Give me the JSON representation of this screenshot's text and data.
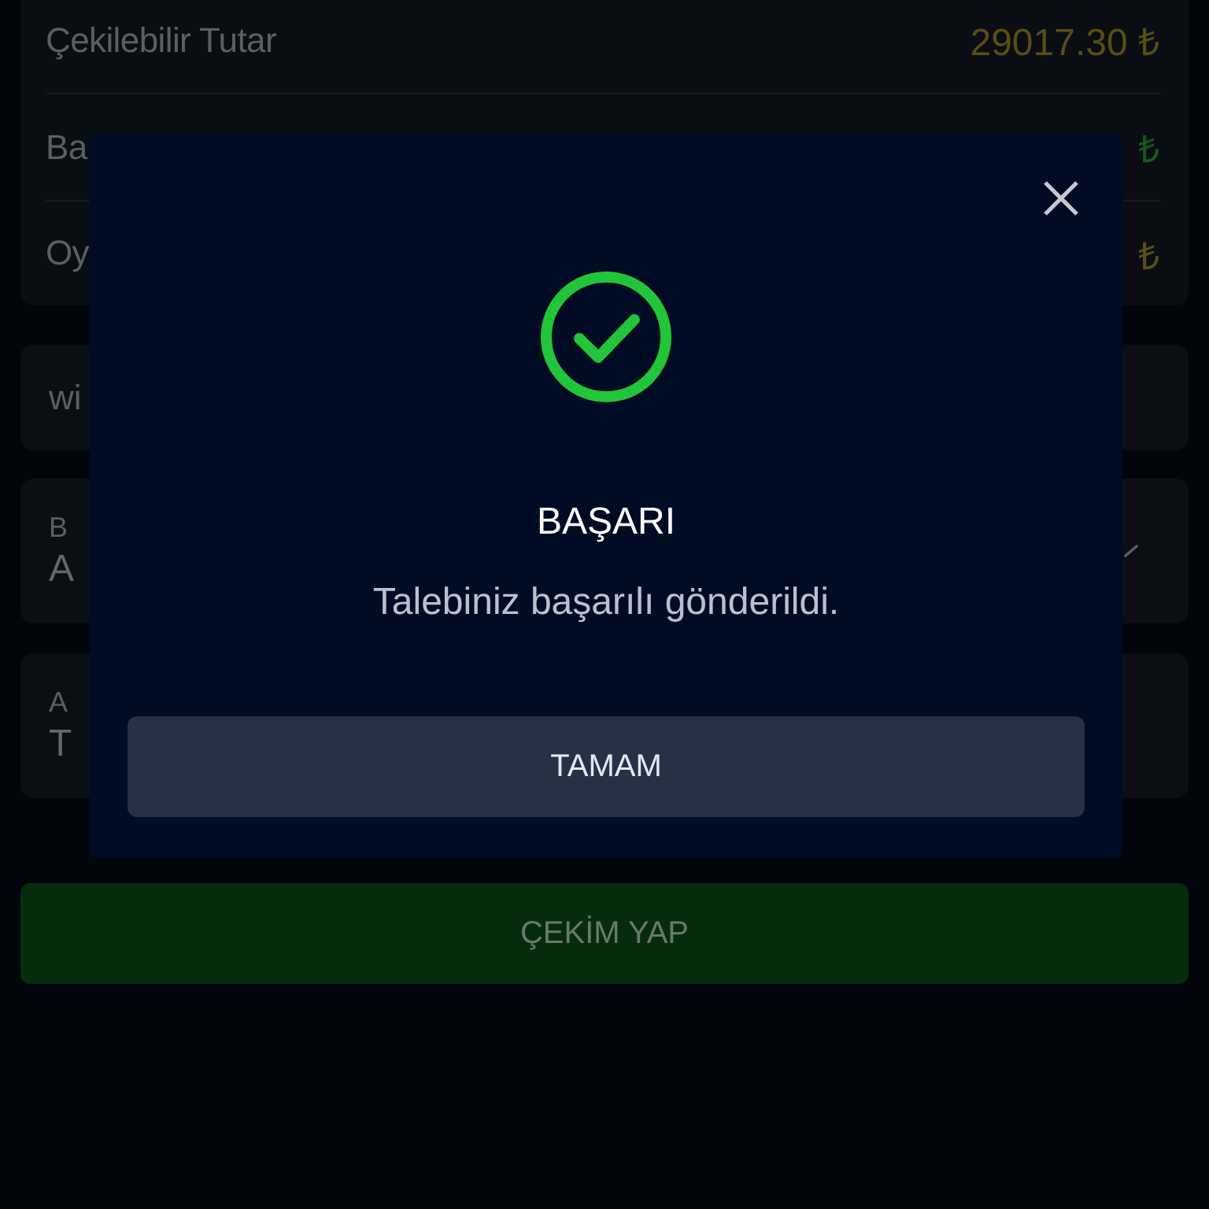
{
  "balance_rows": [
    {
      "label": "Çekilebilir Tutar",
      "value": "29017.30 ₺",
      "color": "#5a4d14"
    },
    {
      "label": "Ba",
      "value": "₺",
      "color": "#17581e"
    },
    {
      "label": "Oy",
      "value": "₺",
      "color": "#5a4d14"
    }
  ],
  "fields": [
    {
      "kind": "text",
      "value": "wi"
    },
    {
      "kind": "select",
      "label": "B",
      "value": "A"
    },
    {
      "kind": "text",
      "label": "A",
      "value": "T"
    }
  ],
  "submit_button": "ÇEKİM YAP",
  "dialog": {
    "title": "BAŞARI",
    "message": "Talebiniz başarılı gönderildi.",
    "button": "TAMAM"
  }
}
